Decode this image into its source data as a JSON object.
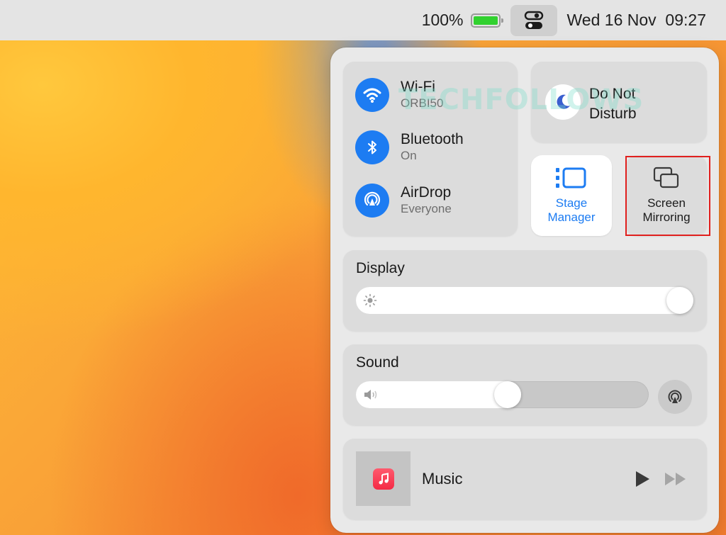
{
  "menubar": {
    "battery_percent": "100%",
    "battery_level": 1.0,
    "datetime": "Wed 16 Nov  09:27"
  },
  "network": {
    "wifi": {
      "title": "Wi-Fi",
      "subtitle": "ORBI50",
      "icon": "wifi-icon"
    },
    "bluetooth": {
      "title": "Bluetooth",
      "subtitle": "On",
      "icon": "bluetooth-icon"
    },
    "airdrop": {
      "title": "AirDrop",
      "subtitle": "Everyone",
      "icon": "airdrop-icon"
    }
  },
  "focus": {
    "label": "Do Not Disturb",
    "icon": "moon-icon"
  },
  "stage_manager": {
    "label": "Stage Manager",
    "icon": "stage-manager-icon"
  },
  "screen_mirroring": {
    "label": "Screen Mirroring",
    "icon": "screen-mirroring-icon"
  },
  "display": {
    "title": "Display",
    "brightness": 1.0
  },
  "sound": {
    "title": "Sound",
    "volume": 0.52
  },
  "now_playing": {
    "app": "Music"
  },
  "watermark": "TECHFOLLOWS",
  "colors": {
    "accent": "#1d7cf2",
    "highlight_box": "#e0201e",
    "battery": "#31d12f",
    "music_brand": "#f42a45"
  }
}
